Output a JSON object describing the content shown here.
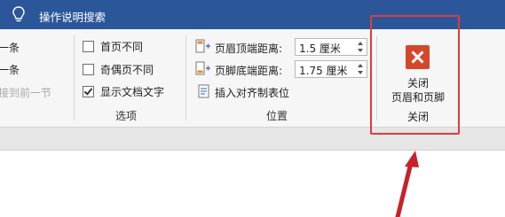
{
  "titlebar": {
    "tell_me": "操作说明搜索"
  },
  "navigation": {
    "prev": "一条",
    "next": "一条",
    "link_previous": "接到前一节"
  },
  "options": {
    "different_first_page": {
      "label": "首页不同",
      "checked": false
    },
    "different_odd_even": {
      "label": "奇偶页不同",
      "checked": false
    },
    "show_document_text": {
      "label": "显示文档文字",
      "checked": true
    },
    "group_label": "选项"
  },
  "position": {
    "header_from_top": {
      "label": "页眉顶端距离:",
      "value": "1.5 厘米"
    },
    "footer_from_bottom": {
      "label": "页脚底端距离:",
      "value": "1.75 厘米"
    },
    "insert_alignment_tab": {
      "label": "插入对齐制表位"
    },
    "group_label": "位置"
  },
  "close": {
    "button_line1": "关闭",
    "button_line2": "页眉和页脚",
    "group_label": "关闭"
  },
  "colors": {
    "titlebar": "#2b579a",
    "highlight": "#e03b3b",
    "close_icon": "#d5472b"
  }
}
